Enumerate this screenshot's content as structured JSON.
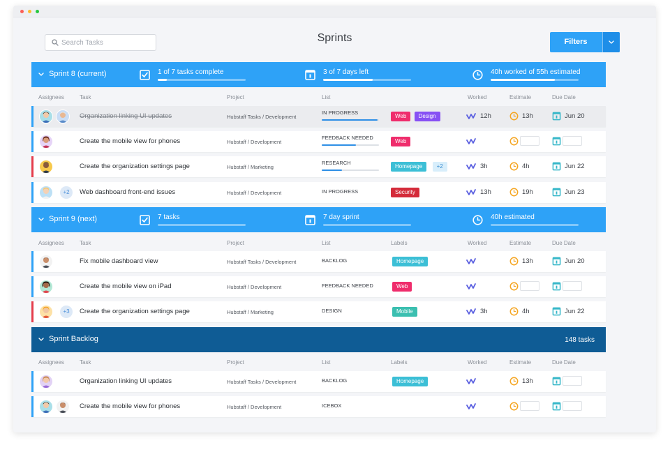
{
  "colors": {
    "blue": "#2ea2f7",
    "darkblue": "#0f5c95",
    "web": "#ef2d6c",
    "design": "#8750f4",
    "homepage": "#3cbfd6",
    "security": "#d42b3a",
    "mobile": "#3bbfb0",
    "worked": "#5a5fe0",
    "estimate": "#f5a623",
    "due": "#36b7c9"
  },
  "search": {
    "placeholder": "Search Tasks"
  },
  "page": {
    "title": "Sprints"
  },
  "filters": {
    "label": "Filters"
  },
  "columns": {
    "assignees": "Assignees",
    "task": "Task",
    "project": "Project",
    "list": "List",
    "labels": "Labels",
    "worked": "Worked",
    "estimate": "Estimate",
    "due": "Due Date"
  },
  "sprints": [
    {
      "name": "Sprint 8 (current)",
      "stat1": "1 of 7 tasks complete",
      "stat1_progress": 0.1,
      "stat2": "3 of 7 days left",
      "stat2_progress": 0.56,
      "stat3": "40h worked of 55h estimated",
      "stat3_progress": 0.73,
      "rows": [
        {
          "task": "Organization linking UI updates",
          "project": "Hubstaff Tasks / Development",
          "list": "IN PROGRESS",
          "list_progress": 0.97,
          "labels": [
            "Web",
            "Design"
          ],
          "worked": "12h",
          "estimate": "13h",
          "due": "Jun 20"
        },
        {
          "task": "Create the mobile view for phones",
          "project": "Hubstaff / Development",
          "list": "FEEDBACK NEEDED",
          "list_progress": 0.6,
          "labels": [
            "Web"
          ],
          "worked": "",
          "estimate": "",
          "due": ""
        },
        {
          "task": "Create the organization settings page",
          "project": "Hubstaff / Marketing",
          "list": "RESEARCH",
          "list_progress": 0.35,
          "labels": [
            "Homepage",
            "+2"
          ],
          "worked": "3h",
          "estimate": "4h",
          "due": "Jun 22"
        },
        {
          "task": "Web dashboard front-end issues",
          "project": "Hubstaff / Development",
          "list": "IN PROGRESS",
          "labels": [
            "Security"
          ],
          "extra": "+2",
          "worked": "13h",
          "estimate": "19h",
          "due": "Jun 23"
        }
      ]
    },
    {
      "name": "Sprint 9 (next)",
      "stat1": "7 tasks",
      "stat2": "7 day sprint",
      "stat3": "40h estimated",
      "rows": [
        {
          "task": "Fix mobile dashboard view",
          "project": "Hubstaff Tasks / Development",
          "list": "BACKLOG",
          "labels": [
            "Homepage"
          ],
          "worked": "",
          "estimate": "13h",
          "due": "Jun 20"
        },
        {
          "task": "Create the mobile view on iPad",
          "project": "Hubstaff / Development",
          "list": "FEEDBACK NEEDED",
          "labels": [
            "Web"
          ],
          "worked": "",
          "estimate": "",
          "due": ""
        },
        {
          "task": "Create the organization settings page",
          "project": "Hubstaff / Marketing",
          "list": "DESIGN",
          "labels": [
            "Mobile"
          ],
          "extra": "+3",
          "worked": "3h",
          "estimate": "4h",
          "due": "Jun 22"
        }
      ]
    },
    {
      "name": "Sprint Backlog",
      "count": "148 tasks",
      "rows": [
        {
          "task": "Organization linking UI updates",
          "project": "Hubstaff Tasks / Development",
          "list": "BACKLOG",
          "labels": [
            "Homepage"
          ],
          "worked": "",
          "estimate": "13h",
          "due": ""
        },
        {
          "task": "Create the mobile view for phones",
          "project": "Hubstaff / Development",
          "list": "ICEBOX",
          "labels": [],
          "worked": "",
          "estimate": "",
          "due": ""
        }
      ]
    }
  ]
}
